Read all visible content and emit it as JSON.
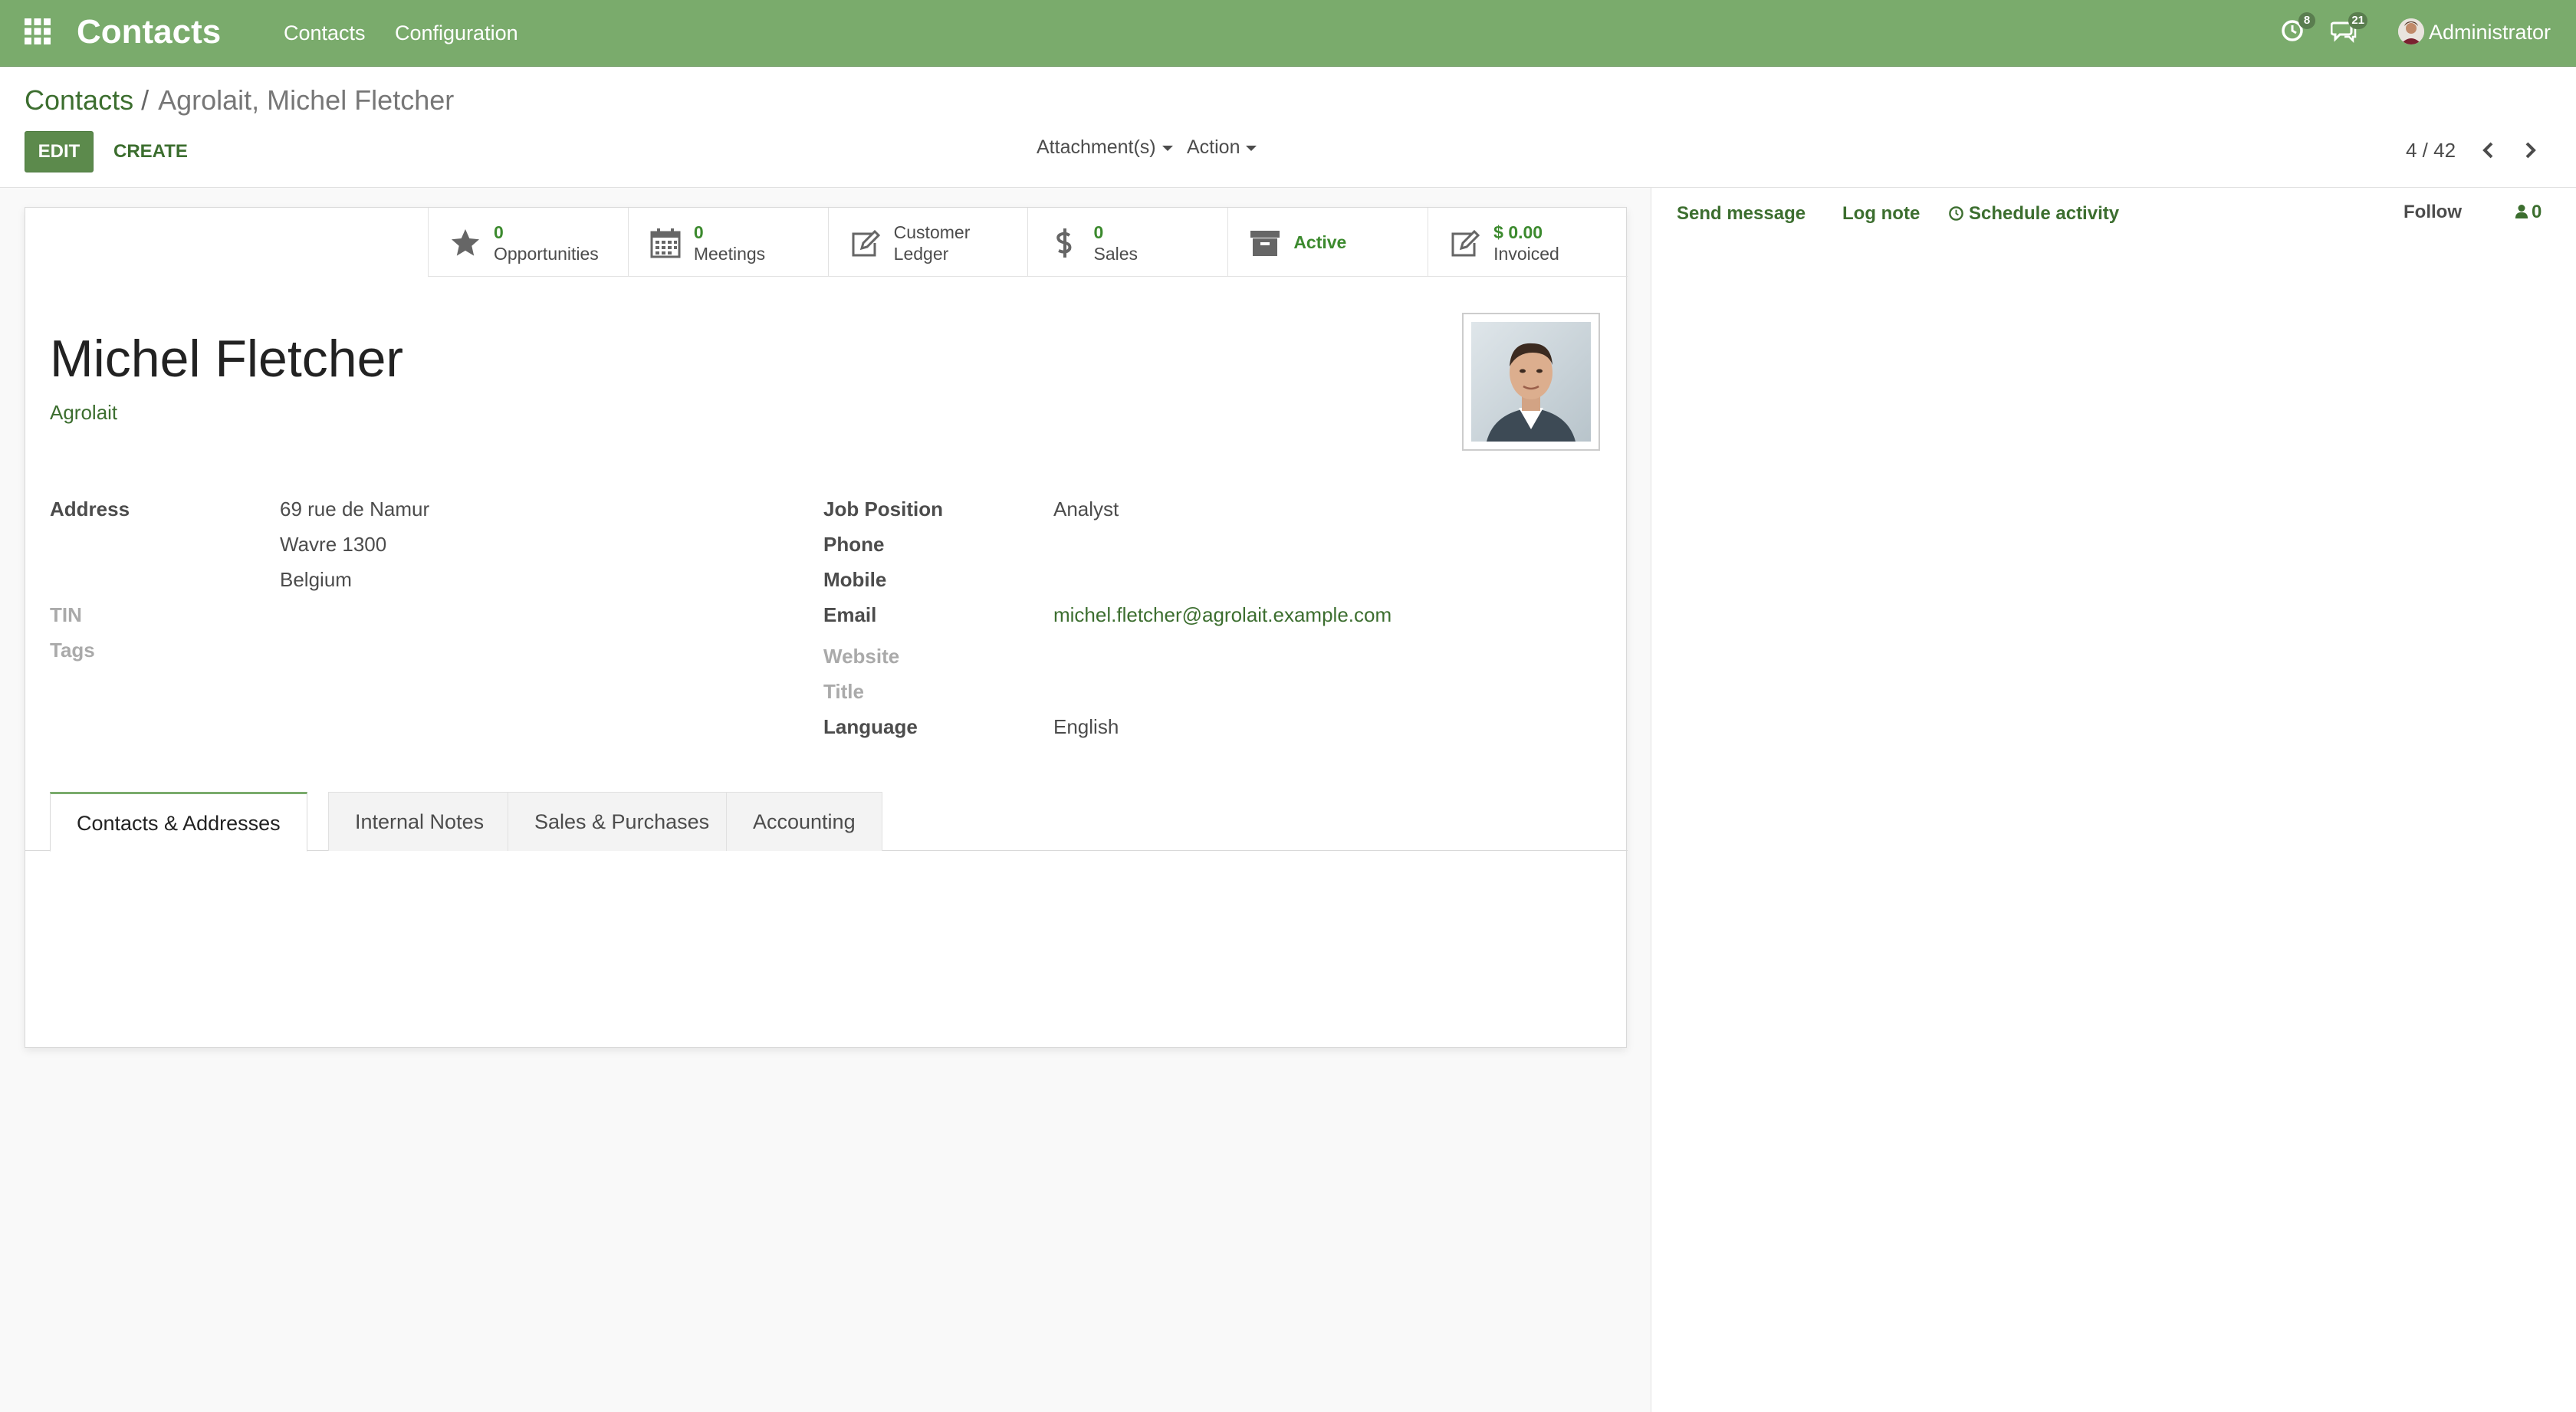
{
  "navbar": {
    "app_title": "Contacts",
    "menu": [
      "Contacts",
      "Configuration"
    ],
    "activity_badge": "8",
    "messages_badge": "21",
    "user_name": "Administrator",
    "bg_color": "#7aab6c"
  },
  "breadcrumb": {
    "parent": "Contacts",
    "separator": "/",
    "current": "Agrolait, Michel Fletcher"
  },
  "toolbar": {
    "edit_label": "EDIT",
    "create_label": "CREATE",
    "attachments_label": "Attachment(s)",
    "action_label": "Action"
  },
  "pager": {
    "value": "4 / 42"
  },
  "stat_buttons": {
    "opportunities": {
      "value": "0",
      "label": "Opportunities",
      "icon": "star-icon"
    },
    "meetings": {
      "value": "0",
      "label": "Meetings",
      "icon": "calendar-icon"
    },
    "customer_ledger": {
      "line1": "Customer",
      "line2": "Ledger",
      "icon": "edit-icon"
    },
    "sales": {
      "value": "0",
      "label": "Sales",
      "icon": "dollar-icon"
    },
    "active": {
      "label": "Active",
      "icon": "archive-icon"
    },
    "invoiced": {
      "value": "$ 0.00",
      "label": "Invoiced",
      "icon": "edit-icon"
    }
  },
  "contact": {
    "name": "Michel Fletcher",
    "company": "Agrolait"
  },
  "fields_left": {
    "address_label": "Address",
    "address_line1": "69 rue de Namur",
    "address_line2": "Wavre  1300",
    "address_line3": "Belgium",
    "tin_label": "TIN",
    "tags_label": "Tags"
  },
  "fields_right": {
    "job_position_label": "Job Position",
    "job_position_value": "Analyst",
    "phone_label": "Phone",
    "mobile_label": "Mobile",
    "email_label": "Email",
    "email_value": "michel.fletcher@agrolait.example.com",
    "website_label": "Website",
    "title_label": "Title",
    "language_label": "Language",
    "language_value": "English"
  },
  "tabs": [
    "Contacts & Addresses",
    "Internal Notes",
    "Sales & Purchases",
    "Accounting"
  ],
  "chatter": {
    "send_message": "Send message",
    "log_note": "Log note",
    "schedule_activity": "Schedule activity",
    "follow": "Follow",
    "followers_count": "0"
  }
}
